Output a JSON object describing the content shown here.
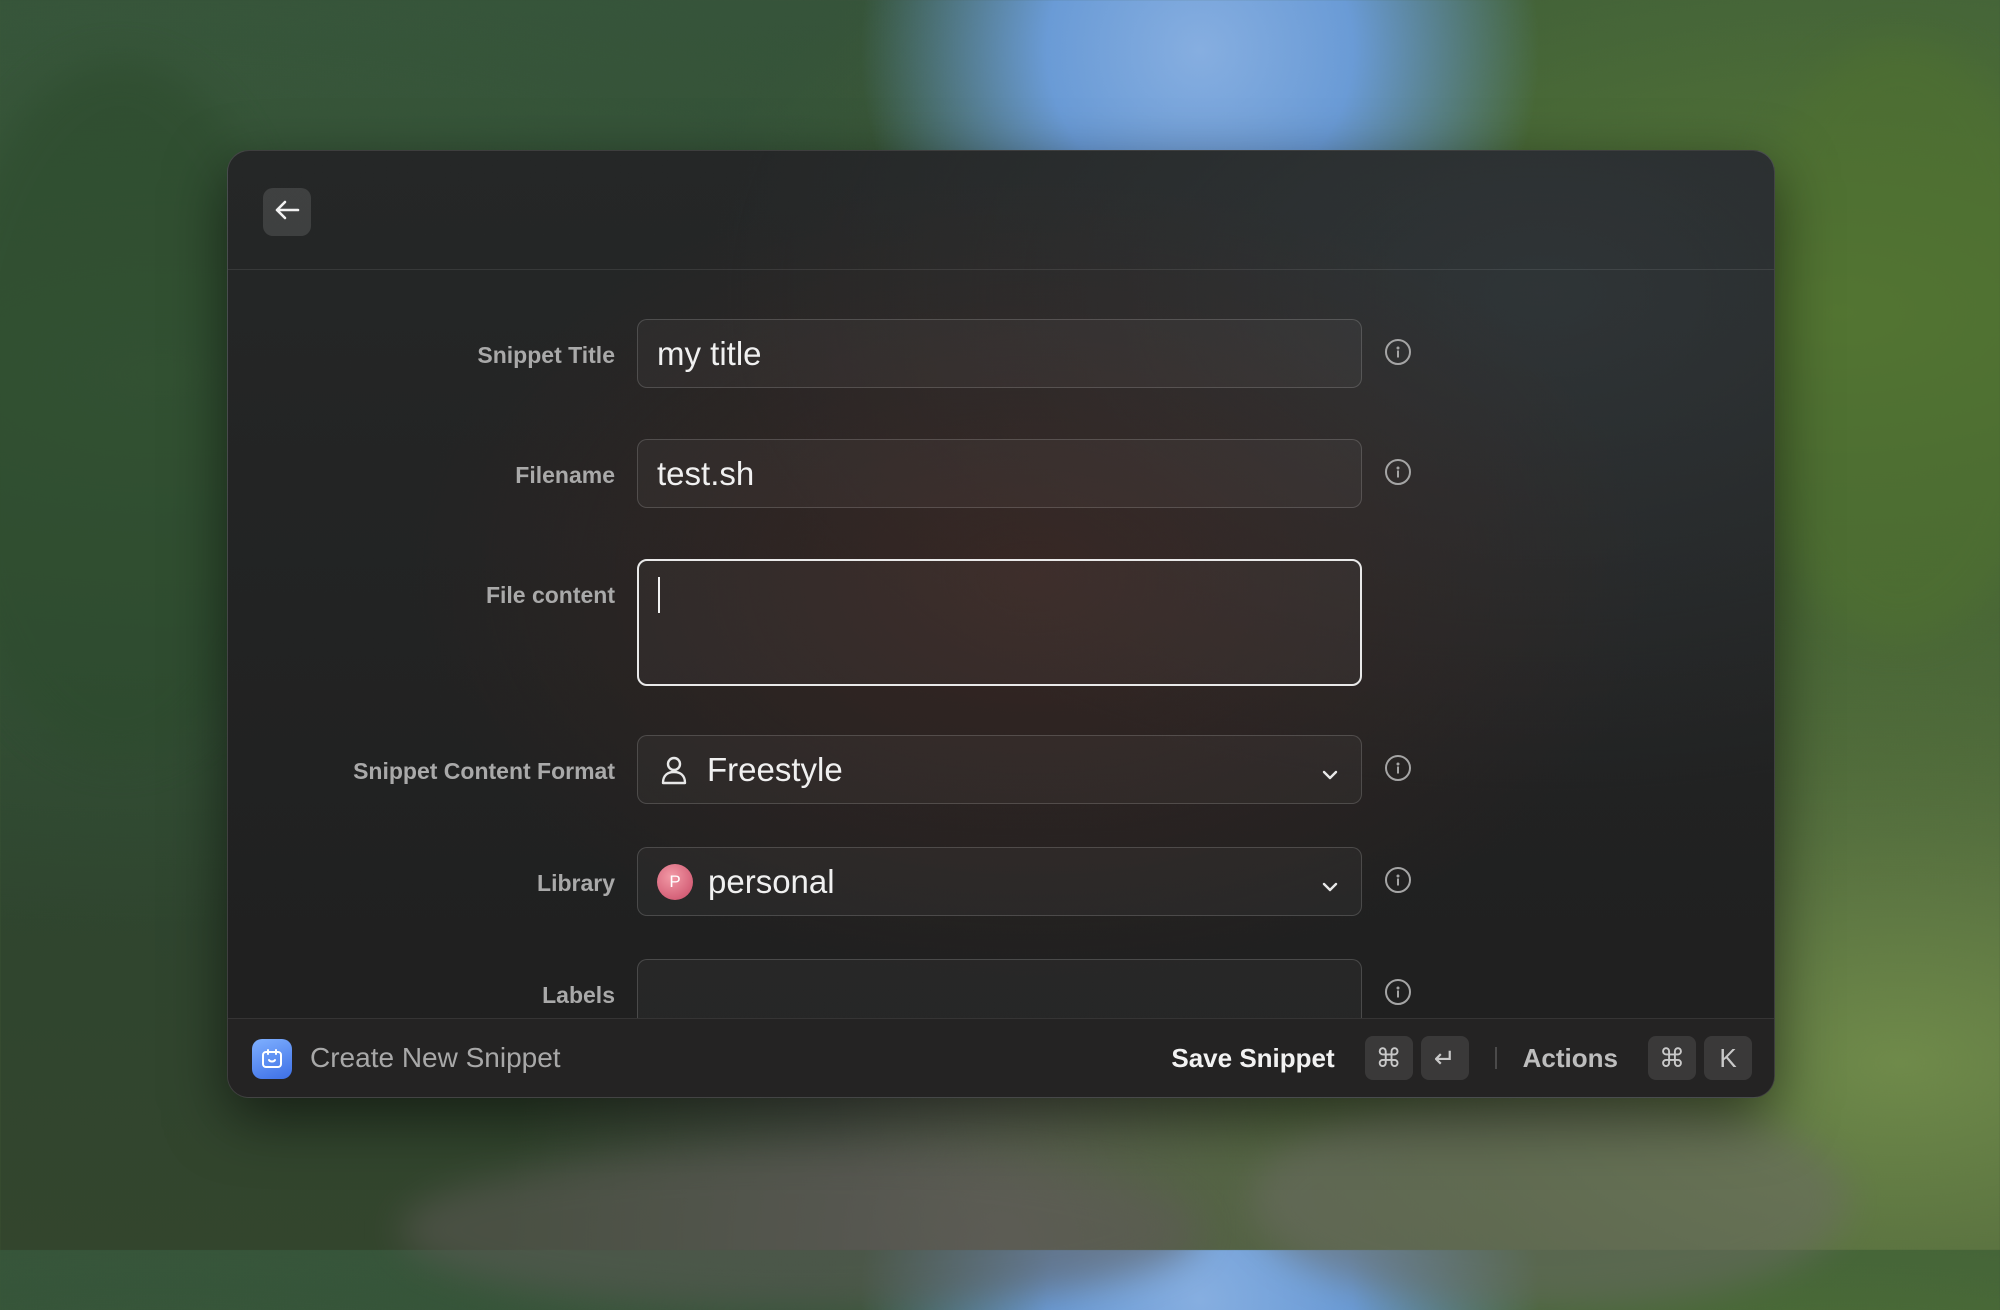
{
  "window": {
    "back_icon": "arrow-left-icon"
  },
  "form": {
    "snippet_title": {
      "label": "Snippet Title",
      "value": "my title",
      "info_icon": "info-icon"
    },
    "filename": {
      "label": "Filename",
      "value": "test.sh",
      "info_icon": "info-icon"
    },
    "file_content": {
      "label": "File content",
      "value": ""
    },
    "content_format": {
      "label": "Snippet Content Format",
      "selected": "Freestyle",
      "icon": "person-icon",
      "info_icon": "info-icon"
    },
    "library": {
      "label": "Library",
      "selected": "personal",
      "avatar_letter": "P",
      "info_icon": "info-icon"
    },
    "labels": {
      "label": "Labels",
      "value": "",
      "info_icon": "info-icon"
    }
  },
  "footer": {
    "app_icon": "snippet-app-icon",
    "title": "Create New Snippet",
    "primary_action": "Save Snippet",
    "primary_shortcut": [
      "⌘",
      "↵"
    ],
    "secondary_action": "Actions",
    "secondary_shortcut": [
      "⌘",
      "K"
    ]
  },
  "colors": {
    "window_bg": "#1f1f1f",
    "label_text": "#a9a9a9",
    "field_text": "#f0f0f0",
    "app_icon_accent": "#3d6fe6",
    "avatar_accent": "#c94a66"
  }
}
